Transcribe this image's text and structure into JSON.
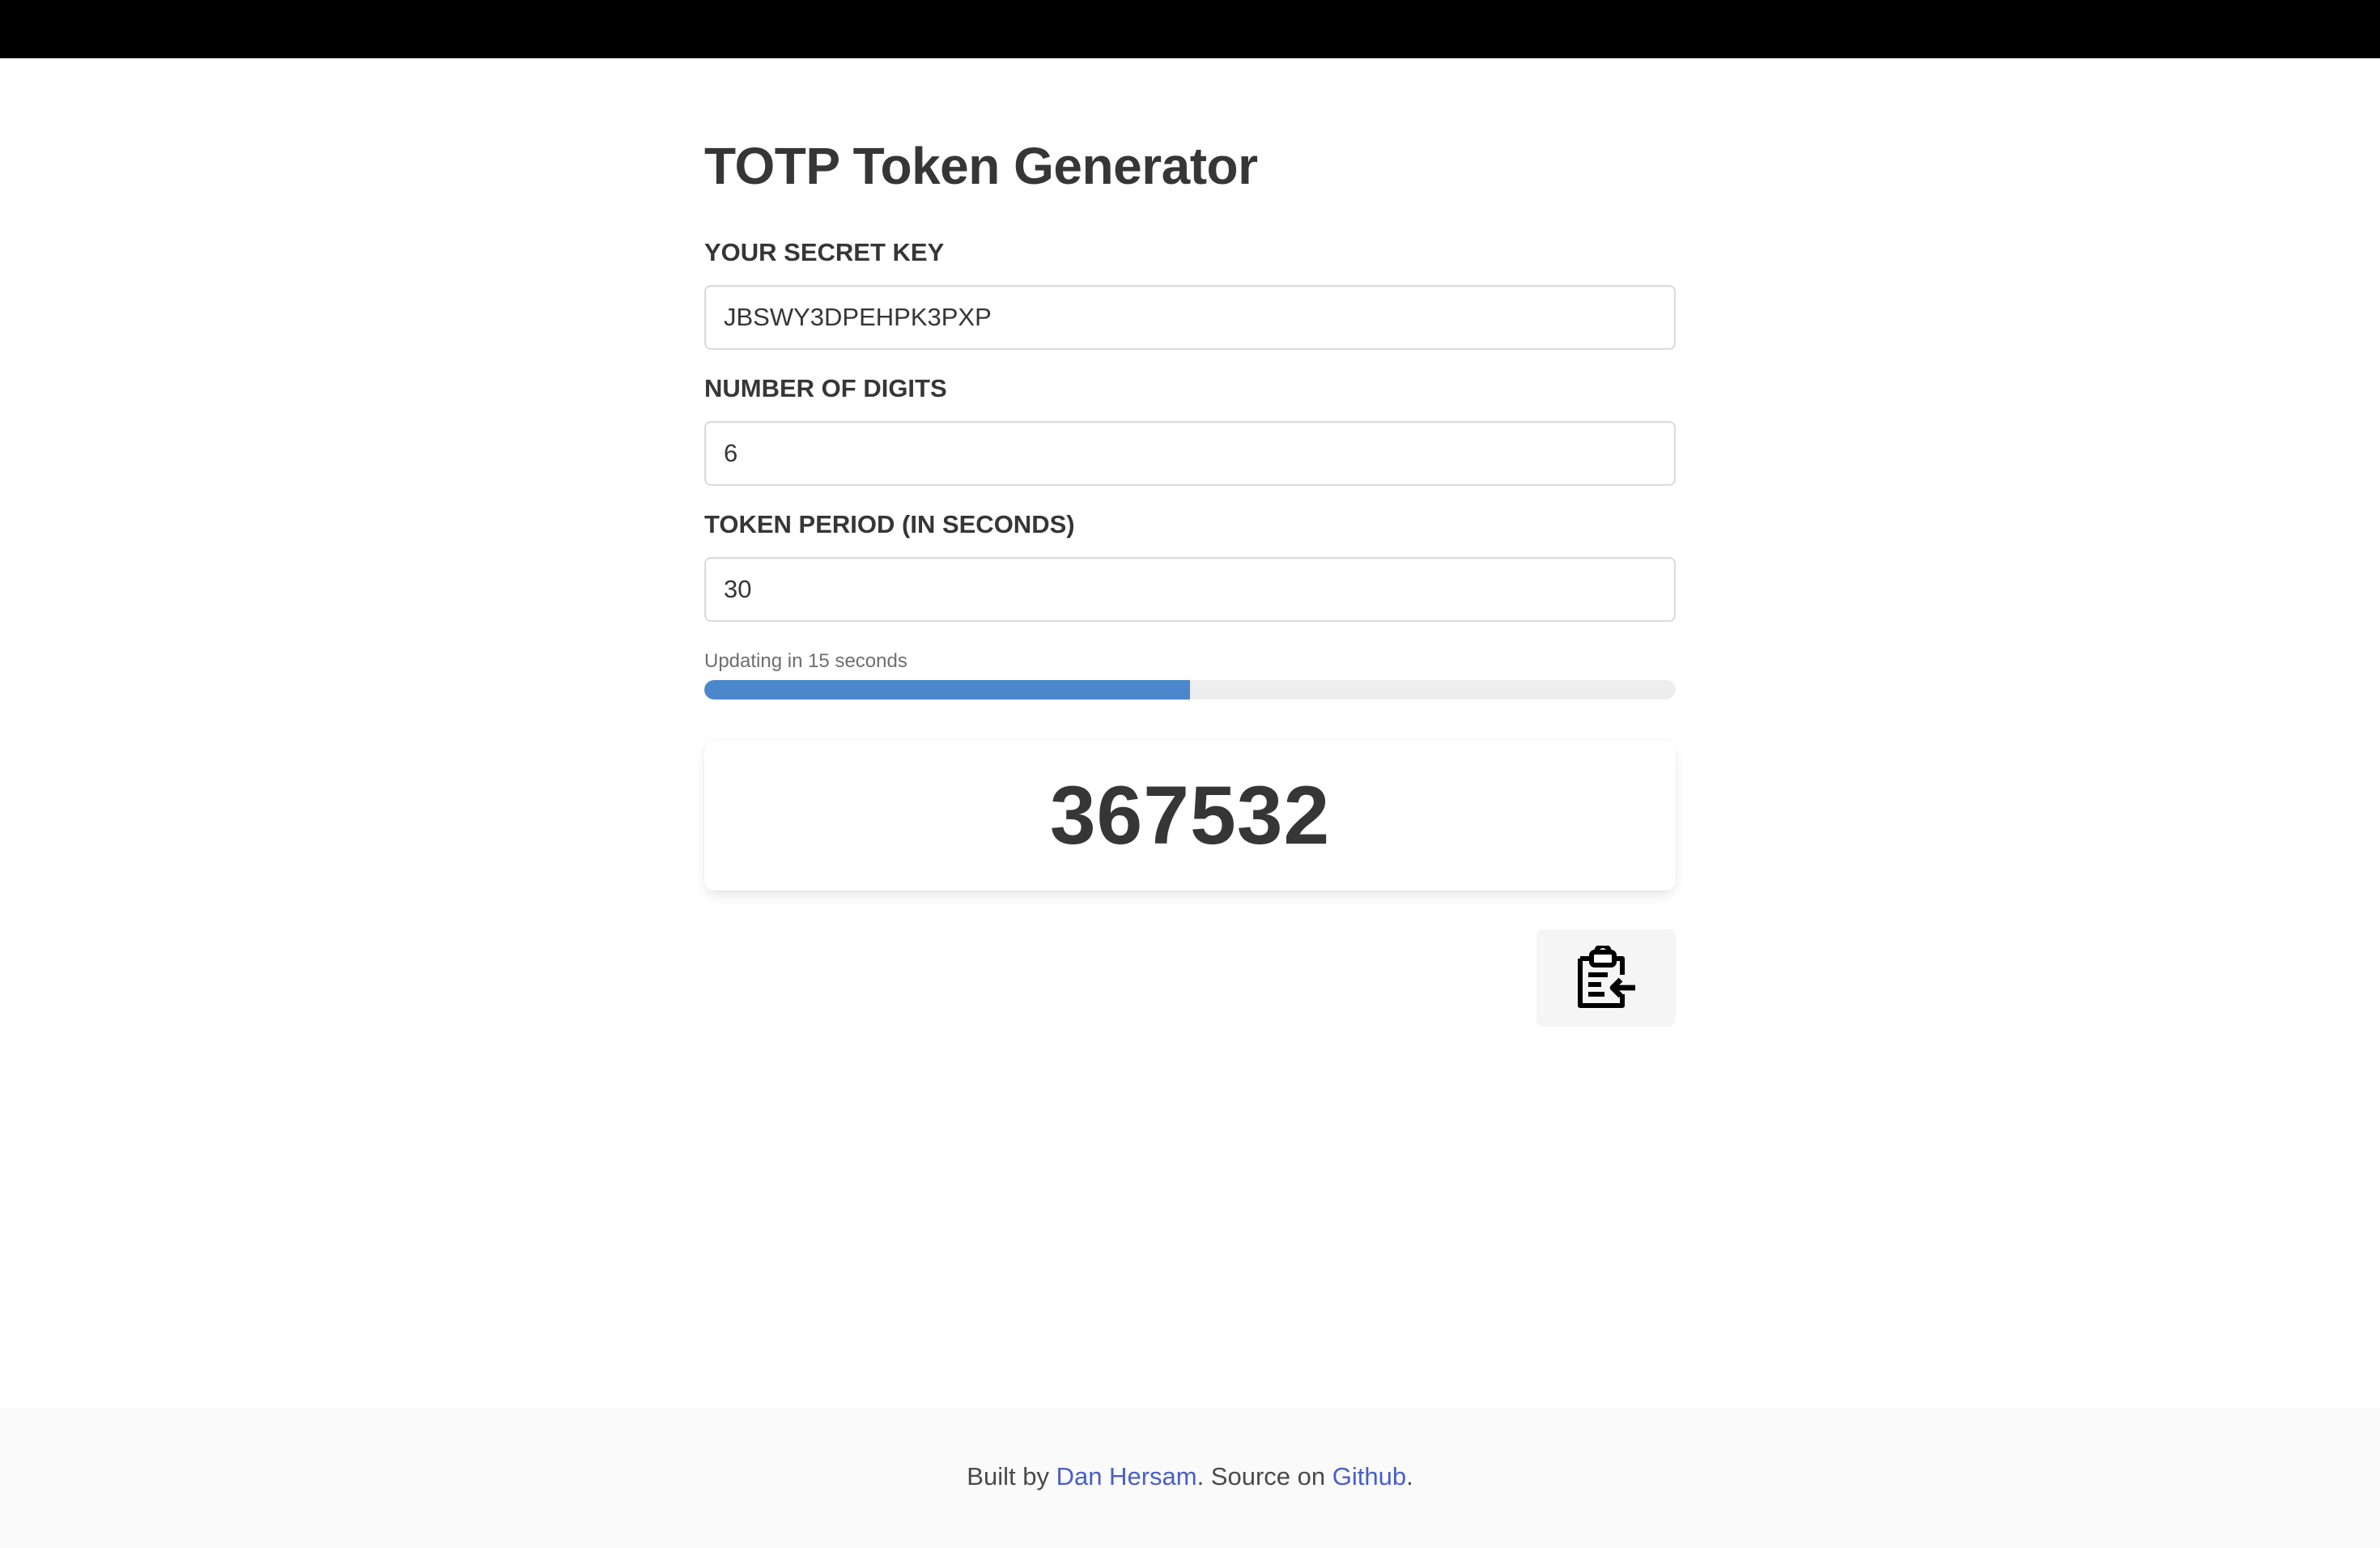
{
  "page": {
    "title": "TOTP Token Generator"
  },
  "form": {
    "secret_label": "YOUR SECRET KEY",
    "secret_value": "JBSWY3DPEHPK3PXP",
    "digits_label": "NUMBER OF DIGITS",
    "digits_value": "6",
    "period_label": "TOKEN PERIOD (IN SECONDS)",
    "period_value": "30"
  },
  "timer": {
    "updating_text": "Updating in 15 seconds",
    "progress_fraction": 0.5,
    "progress_color": "#4a87cc"
  },
  "token": {
    "value": "367532"
  },
  "copy_button": {
    "icon": "clipboard-copy-icon"
  },
  "footer": {
    "prefix": "Built by ",
    "author": "Dan Hersam",
    "middle": ". Source on ",
    "source": "Github",
    "suffix": "."
  },
  "colors": {
    "link": "#485fc7",
    "topbar": "#000000"
  }
}
